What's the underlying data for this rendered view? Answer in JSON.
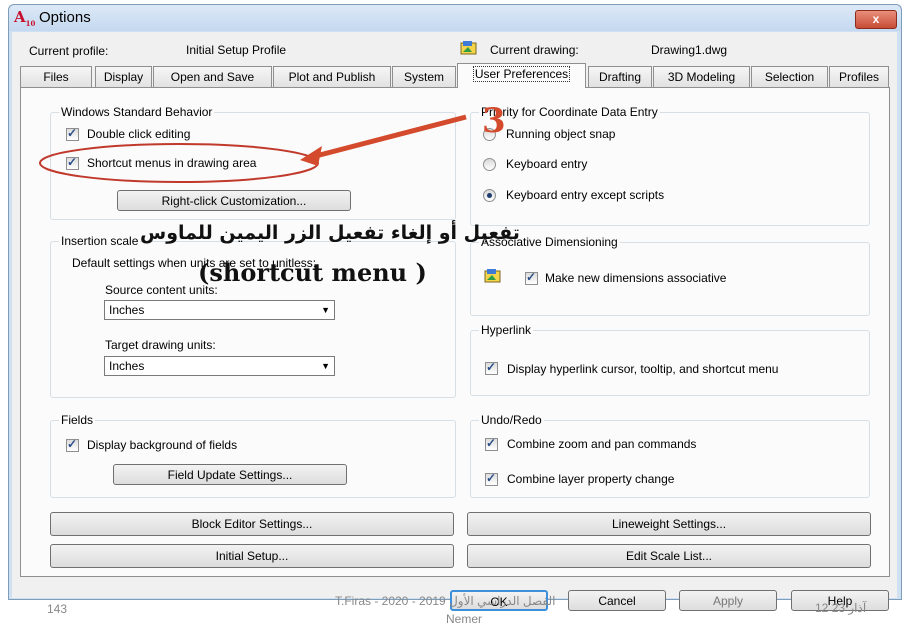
{
  "window": {
    "title": "Options",
    "close_symbol": "x",
    "app_icon_text": "A",
    "app_icon_sub": "10"
  },
  "profile": {
    "current_profile_label": "Current profile:",
    "current_profile_value": "Initial Setup Profile",
    "current_drawing_label": "Current drawing:",
    "current_drawing_value": "Drawing1.dwg"
  },
  "tabs": [
    {
      "label": "Files"
    },
    {
      "label": "Display"
    },
    {
      "label": "Open and Save"
    },
    {
      "label": "Plot and Publish"
    },
    {
      "label": "System"
    },
    {
      "label": "User Preferences",
      "active": true
    },
    {
      "label": "Drafting"
    },
    {
      "label": "3D Modeling"
    },
    {
      "label": "Selection"
    },
    {
      "label": "Profiles"
    }
  ],
  "windows_standard": {
    "title": "Windows Standard Behavior",
    "double_click": "Double click editing",
    "shortcut_menus": "Shortcut menus in drawing area",
    "right_click_button": "Right-click Customization..."
  },
  "insertion_scale": {
    "title": "Insertion scale",
    "subtitle": "Default settings when units are set to unitless:",
    "source_label": "Source content units:",
    "source_value": "Inches",
    "target_label": "Target drawing units:",
    "target_value": "Inches"
  },
  "fields": {
    "title": "Fields",
    "display_background": "Display background of fields",
    "update_button": "Field Update Settings..."
  },
  "priority": {
    "title": "Priority for Coordinate Data Entry",
    "running_snap": "Running object snap",
    "keyboard_entry": "Keyboard entry",
    "keyboard_except": "Keyboard entry except scripts"
  },
  "assoc_dim": {
    "title": "Associative Dimensioning",
    "make_assoc": "Make new dimensions associative"
  },
  "hyperlink": {
    "title": "Hyperlink",
    "display_cursor": "Display hyperlink cursor, tooltip, and shortcut menu"
  },
  "undo_redo": {
    "title": "Undo/Redo",
    "combine_zoom": "Combine zoom and pan commands",
    "combine_layer": "Combine layer property change"
  },
  "buttons": {
    "block_editor": "Block Editor Settings...",
    "initial_setup": "Initial Setup...",
    "lineweight": "Lineweight Settings...",
    "edit_scale": "Edit Scale List...",
    "ok": "OK",
    "cancel": "Cancel",
    "apply": "Apply",
    "help": "Help"
  },
  "annotation": {
    "step_number": "3",
    "arabic_text": "تفعيل أو إلغاء تفعيل الزر اليمين للماوس",
    "english_text": "(shortcut menu )",
    "arrow_color": "#d44a2c"
  },
  "footer": {
    "page_number": "143",
    "author": "T.Firas - 2020 - 2019 الفصل الدراسي الأول",
    "author_line2": "Nemer",
    "date": "12 آذار 23"
  }
}
